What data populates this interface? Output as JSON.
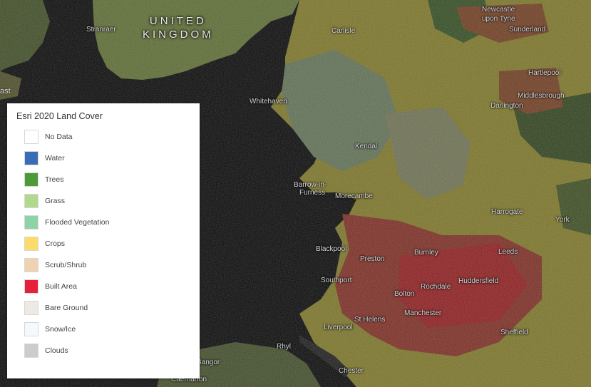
{
  "map": {
    "country_label_line1": "UNITED",
    "country_label_line2": "KINGDOM",
    "places": {
      "stranraer": "Stranraer",
      "carlisle": "Carlisle",
      "newcastle": "Newcastle",
      "upon_tyne": "upon Tyne",
      "sunderland": "Sunderland",
      "hartlepool": "Hartlepool",
      "middlesbrough": "Middlesbrough",
      "darlington": "Darlington",
      "whitehaven": "Whitehaven",
      "kendal": "Kendal",
      "barrow": "Barrow-in-",
      "furness": "Furness",
      "morecambe": "Morecambe",
      "harrogate": "Harrogate",
      "york": "York",
      "blackpool": "Blackpool",
      "preston": "Preston",
      "burnley": "Burnley",
      "leeds": "Leeds",
      "southport": "Southport",
      "bolton": "Bolton",
      "rochdale": "Rochdale",
      "huddersfield": "Huddersfield",
      "st_helens": "St Helens",
      "manchester": "Manchester",
      "liverpool": "Liverpool",
      "sheffield": "Sheffield",
      "rhyl": "Rhyl",
      "chester": "Chester",
      "bangor": "Bangor",
      "caernarfon": "Caernarfon",
      "belfast_partial": "ast"
    }
  },
  "legend": {
    "title": "Esri 2020 Land Cover",
    "items": [
      {
        "label": "No Data",
        "color": "#ffffff"
      },
      {
        "label": "Water",
        "color": "#3a6db5"
      },
      {
        "label": "Trees",
        "color": "#4c9a38"
      },
      {
        "label": "Grass",
        "color": "#b2d88e"
      },
      {
        "label": "Flooded Vegetation",
        "color": "#8dd3a7"
      },
      {
        "label": "Crops",
        "color": "#fbdc6a"
      },
      {
        "label": "Scrub/Shrub",
        "color": "#efd2b0"
      },
      {
        "label": "Built Area",
        "color": "#e8213b"
      },
      {
        "label": "Bare Ground",
        "color": "#ede9e4"
      },
      {
        "label": "Snow/Ice",
        "color": "#f2fafe"
      },
      {
        "label": "Clouds",
        "color": "#cccccc"
      }
    ]
  }
}
